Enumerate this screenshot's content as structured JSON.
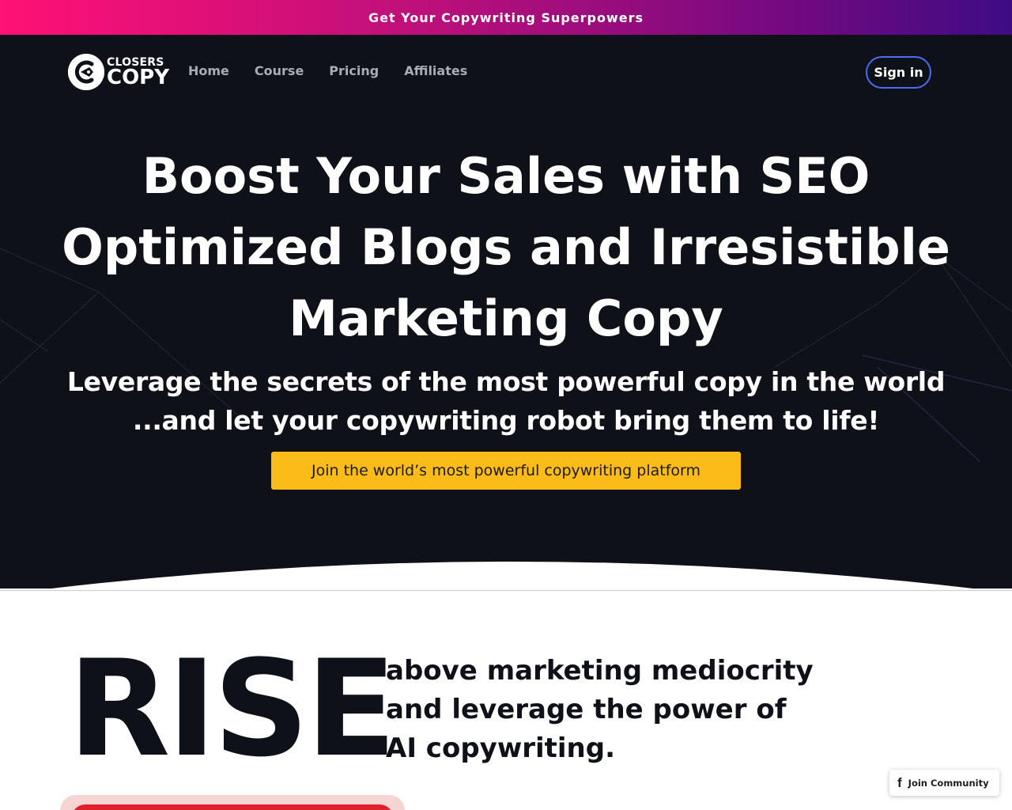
{
  "promo": {
    "text": "Get Your Copywriting Superpowers"
  },
  "brand": {
    "line1": "CLOSERS",
    "line2": "COPY"
  },
  "nav": {
    "items": [
      "Home",
      "Course",
      "Pricing",
      "Affiliates"
    ]
  },
  "header": {
    "signin_label": "Sign in"
  },
  "hero": {
    "title_line1": "Boost Your Sales with SEO",
    "title_line2": "Optimized Blogs and Irresistible",
    "title_line3": "Marketing Copy",
    "subtitle_line1": "Leverage the secrets of the most powerful copy in the world",
    "subtitle_line2": "...and let your copywriting robot bring them to life!",
    "cta_label": "Join the world’s most powerful copywriting platform"
  },
  "rise": {
    "headline": "RISE",
    "line1": "above marketing mediocrity",
    "line2": "and leverage the power of",
    "line3": "AI copywriting."
  },
  "widget": {
    "label": "Join Community",
    "icon": "facebook-icon"
  },
  "colors": {
    "hero_bg": "#0f1119",
    "cta_bg": "#fbbc1a",
    "signin_border": "#4a6cf7",
    "promo_start": "#ff1175",
    "promo_end": "#3e0b83"
  }
}
